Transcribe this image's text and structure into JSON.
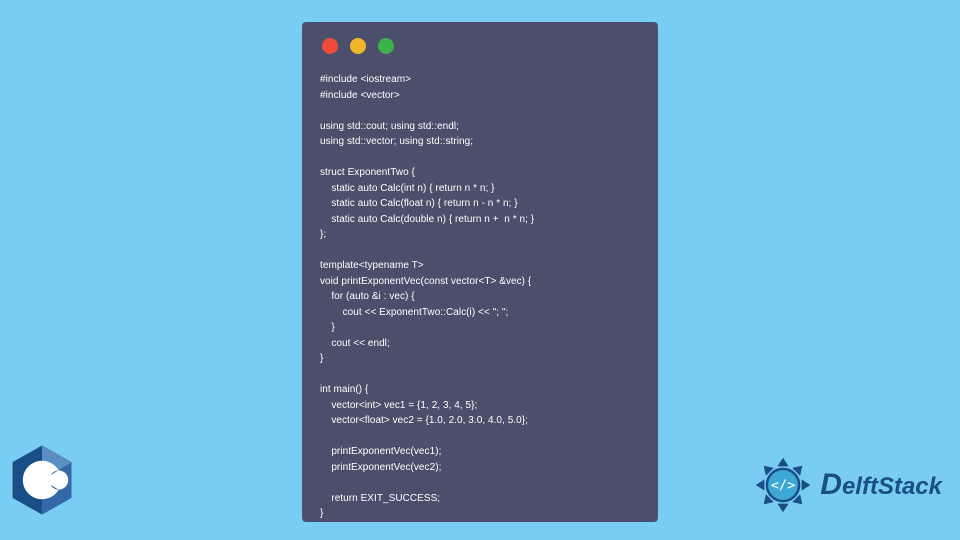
{
  "window": {
    "dots": [
      "red",
      "yellow",
      "green"
    ]
  },
  "code": {
    "lines": [
      "#include <iostream>",
      "#include <vector>",
      "",
      "using std::cout; using std::endl;",
      "using std::vector; using std::string;",
      "",
      "struct ExponentTwo {",
      "    static auto Calc(int n) { return n * n; }",
      "    static auto Calc(float n) { return n - n * n; }",
      "    static auto Calc(double n) { return n +  n * n; }",
      "};",
      "",
      "template<typename T>",
      "void printExponentVec(const vector<T> &vec) {",
      "    for (auto &i : vec) {",
      "        cout << ExponentTwo::Calc(i) << \"; \";",
      "    }",
      "    cout << endl;",
      "}",
      "",
      "int main() {",
      "    vector<int> vec1 = {1, 2, 3, 4, 5};",
      "    vector<float> vec2 = {1.0, 2.0, 3.0, 4.0, 5.0};",
      "",
      "    printExponentVec(vec1);",
      "    printExponentVec(vec2);",
      "",
      "    return EXIT_SUCCESS;",
      "}"
    ]
  },
  "badges": {
    "cpp": "C++",
    "brand_first": "D",
    "brand_rest": "elftStack"
  },
  "colors": {
    "bg": "#79ccf2",
    "window": "#4b4f6b",
    "dot_red": "#ed4c3b",
    "dot_yellow": "#f1b52c",
    "dot_green": "#3cb24a",
    "cpp_blue": "#1a4e87",
    "brand_blue": "#1a4e87"
  }
}
